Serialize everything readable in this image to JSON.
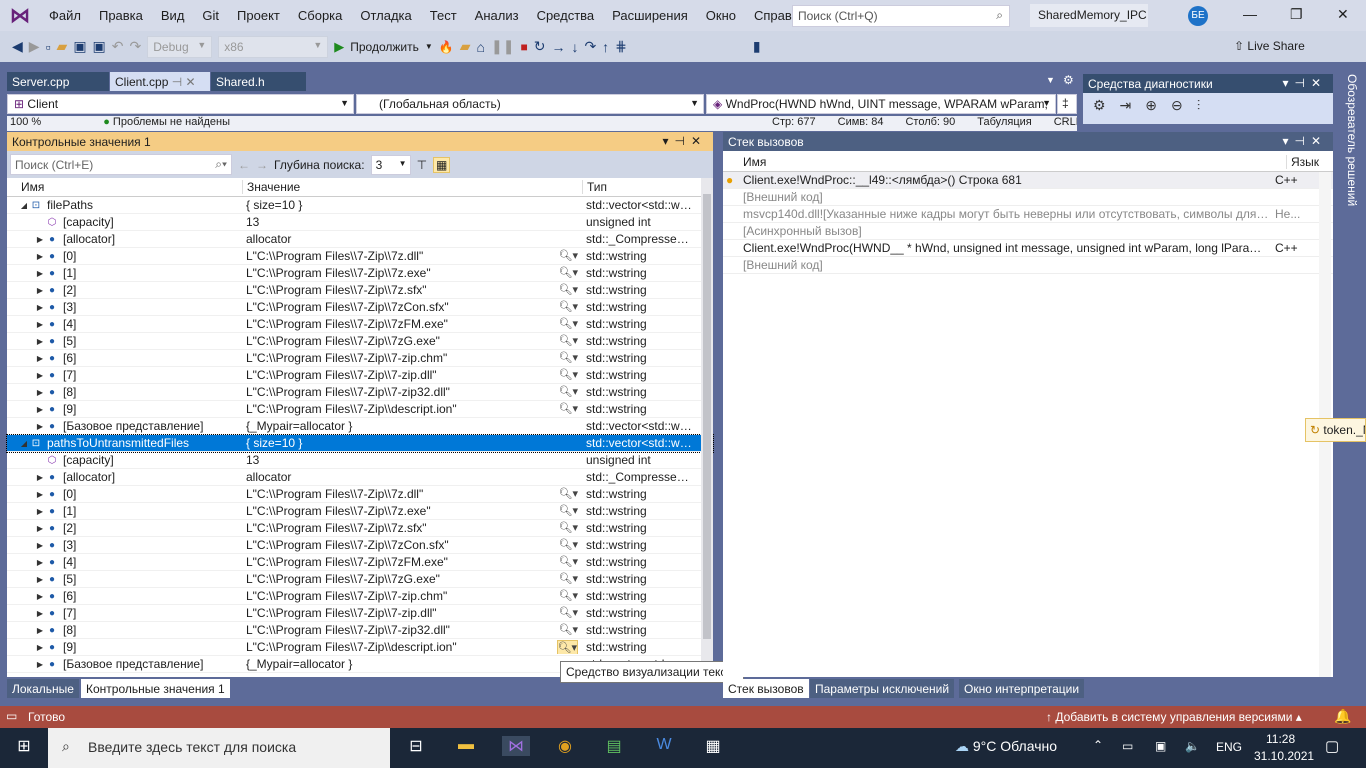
{
  "menubar": {
    "items": [
      "Файл",
      "Правка",
      "Вид",
      "Git",
      "Проект",
      "Сборка",
      "Отладка",
      "Тест",
      "Анализ",
      "Средства",
      "Расширения",
      "Окно",
      "Справка"
    ],
    "search_placeholder": "Поиск (Ctrl+Q)",
    "solution": "SharedMemory_IPC",
    "avatar": "БЕ"
  },
  "toolbar": {
    "config": "Debug",
    "platform": "x86",
    "continue": "Продолжить",
    "liveshare": "Live Share"
  },
  "editor": {
    "tabs": [
      "Server.cpp",
      "Client.cpp",
      "Shared.h"
    ],
    "project": "Client",
    "scope": "(Глобальная область)",
    "function": "WndProc(HWND hWnd, UINT message, WPARAM wParam,",
    "zoom": "100 %",
    "issues": "Проблемы не найдены",
    "line": "Стр: 677",
    "char": "Симв: 84",
    "col": "Столб: 90",
    "tabs_mode": "Табуляция",
    "eol": "CRLF"
  },
  "diagnostics": {
    "title": "Средства диагностики"
  },
  "watch": {
    "title": "Контрольные значения 1",
    "search_placeholder": "Поиск (Ctrl+E)",
    "depth_label": "Глубина поиска:",
    "depth": "3",
    "columns": [
      "Имя",
      "Значение",
      "Тип"
    ],
    "groups": [
      {
        "name": "filePaths",
        "value": "{ size=10 }",
        "type": "std::vector<std::ws...",
        "selected": false
      },
      {
        "name": "pathsToUntransmittedFiles",
        "value": "{ size=10 }",
        "type": "std::vector<std::ws...",
        "selected": true
      }
    ],
    "children": [
      {
        "name": "[capacity]",
        "value": "13",
        "type": "unsigned int"
      },
      {
        "name": "[allocator]",
        "value": "allocator",
        "type": "std::_Compressed_..."
      },
      {
        "name": "[0]",
        "value": "L\"C:\\\\Program Files\\\\7-Zip\\\\7z.dll\"",
        "type": "std::wstring"
      },
      {
        "name": "[1]",
        "value": "L\"C:\\\\Program Files\\\\7-Zip\\\\7z.exe\"",
        "type": "std::wstring"
      },
      {
        "name": "[2]",
        "value": "L\"C:\\\\Program Files\\\\7-Zip\\\\7z.sfx\"",
        "type": "std::wstring"
      },
      {
        "name": "[3]",
        "value": "L\"C:\\\\Program Files\\\\7-Zip\\\\7zCon.sfx\"",
        "type": "std::wstring"
      },
      {
        "name": "[4]",
        "value": "L\"C:\\\\Program Files\\\\7-Zip\\\\7zFM.exe\"",
        "type": "std::wstring"
      },
      {
        "name": "[5]",
        "value": "L\"C:\\\\Program Files\\\\7-Zip\\\\7zG.exe\"",
        "type": "std::wstring"
      },
      {
        "name": "[6]",
        "value": "L\"C:\\\\Program Files\\\\7-Zip\\\\7-zip.chm\"",
        "type": "std::wstring"
      },
      {
        "name": "[7]",
        "value": "L\"C:\\\\Program Files\\\\7-Zip\\\\7-zip.dll\"",
        "type": "std::wstring"
      },
      {
        "name": "[8]",
        "value": "L\"C:\\\\Program Files\\\\7-Zip\\\\7-zip32.dll\"",
        "type": "std::wstring"
      },
      {
        "name": "[9]",
        "value": "L\"C:\\\\Program Files\\\\7-Zip\\\\descript.ion\"",
        "type": "std::wstring"
      },
      {
        "name": "[Базовое представление]",
        "value": "{_Mypair=allocator }",
        "type": "std::vector<std::ws..."
      }
    ],
    "tooltip": "Средство визуализации текста",
    "bottom_tabs": [
      "Локальные",
      "Контрольные значения 1"
    ]
  },
  "callstack": {
    "title": "Стек вызовов",
    "columns": [
      "Имя",
      "Язык"
    ],
    "rows": [
      {
        "name": "Client.exe!WndProc::__l49::<лямбда>() Строка 681",
        "lang": "C++",
        "grey": false,
        "current": true
      },
      {
        "name": "[Внешний код]",
        "lang": "",
        "grey": true
      },
      {
        "name": "msvcp140d.dll![Указанные ниже кадры могут быть неверны или отсутствовать, символы для ms...",
        "lang": "Не...",
        "grey": true
      },
      {
        "name": "[Асинхронный вызов]",
        "lang": "",
        "grey": true
      },
      {
        "name": "Client.exe!WndProc(HWND__ * hWnd, unsigned int message, unsigned int wParam, long lParam) Ст...",
        "lang": "C++",
        "grey": false
      },
      {
        "name": "[Внешний код]",
        "lang": "",
        "grey": true
      }
    ],
    "bottom_tabs": [
      "Стек вызовов",
      "Параметры исключений",
      "Окно интерпретации"
    ]
  },
  "side_tab": "Обозреватель решений",
  "floating_tip": "token._M",
  "status": {
    "ready": "Готово",
    "vcs": "Добавить в систему управления версиями"
  },
  "taskbar": {
    "search_placeholder": "Введите здесь текст для поиска",
    "weather": "9°C  Облачно",
    "lang": "ENG",
    "time": "11:28",
    "date": "31.10.2021"
  },
  "colors": {
    "accent": "#0078d7",
    "status_bar": "#a84b3f",
    "active_title": "#f5cc84"
  }
}
